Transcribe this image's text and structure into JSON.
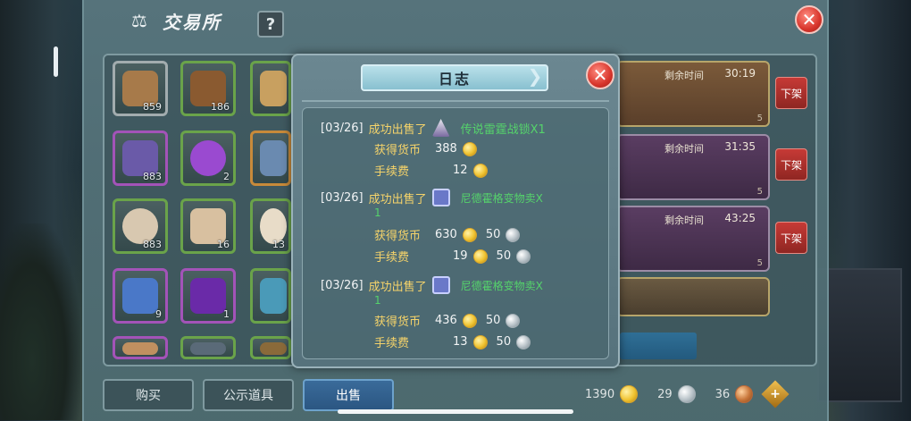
{
  "window": {
    "title": "交易所",
    "help_label": "?",
    "close_label": "✕"
  },
  "inventory": [
    {
      "count": "859",
      "color": "#a77a4a",
      "icon": "wood-log-icon"
    },
    {
      "count": "186",
      "color": "#8a5a30",
      "icon": "stump-icon"
    },
    {
      "count": "",
      "color": "#c8a060",
      "icon": "crystal-cluster-icon"
    },
    {
      "count": "883",
      "color": "#6a5aa8",
      "icon": "purple-crystal-icon"
    },
    {
      "count": "2",
      "color": "#9a4ad0",
      "icon": "magic-orb-icon"
    },
    {
      "count": "",
      "color": "#6a8ab0",
      "icon": "blue-item-icon"
    },
    {
      "count": "883",
      "color": "#d8c8b0",
      "icon": "dumpling-icon"
    },
    {
      "count": "16",
      "color": "#d8c0a0",
      "icon": "ladle-icon"
    },
    {
      "count": "13",
      "color": "#e8dcc8",
      "icon": "bowl-icon"
    },
    {
      "count": "9",
      "color": "#4a78c8",
      "icon": "blue-gem-icon"
    },
    {
      "count": "1",
      "color": "#6a2aa8",
      "icon": "purple-gem-icon"
    },
    {
      "count": "",
      "color": "#4a9ab8",
      "icon": "blue-shard-icon"
    },
    {
      "count": "",
      "color": "#c09060",
      "icon": "figure-icon"
    },
    {
      "count": "",
      "color": "#5a6a78",
      "icon": "gear-item-icon"
    },
    {
      "count": "",
      "color": "#8a6a3a",
      "icon": "pot-icon"
    }
  ],
  "listings": [
    {
      "time_label": "剩余时间",
      "time": "30:19",
      "num": "5",
      "unlist": "下架"
    },
    {
      "time_label": "剩余时间",
      "time": "31:35",
      "num": "5",
      "unlist": "下架"
    },
    {
      "time_label": "剩余时间",
      "time": "43:25",
      "num": "5",
      "unlist": "下架"
    },
    {
      "time_label": "",
      "time": "",
      "num": "",
      "unlist": ""
    }
  ],
  "tabs": [
    {
      "label": "购买"
    },
    {
      "label": "公示道具"
    },
    {
      "label": "出售"
    }
  ],
  "currency": {
    "gold": "1390",
    "silver": "29",
    "copper": "36",
    "add_label": "+"
  },
  "log": {
    "title": "日志",
    "sold_label": "成功出售了",
    "earned_label": "获得货币",
    "fee_label": "手续费",
    "entries": [
      {
        "date": "[03/26]",
        "item": "传说雷霆战锁X1",
        "item_tail": "",
        "earned_gold": "388",
        "earned_silver": "",
        "fee_gold": "12",
        "fee_silver": ""
      },
      {
        "date": "[03/26]",
        "item": "尼德霍格变物卖X",
        "item_tail": "1",
        "earned_gold": "630",
        "earned_silver": "50",
        "fee_gold": "19",
        "fee_silver": "50"
      },
      {
        "date": "[03/26]",
        "item": "尼德霍格变物卖X",
        "item_tail": "1",
        "earned_gold": "436",
        "earned_silver": "50",
        "fee_gold": "13",
        "fee_silver": "50"
      }
    ]
  }
}
